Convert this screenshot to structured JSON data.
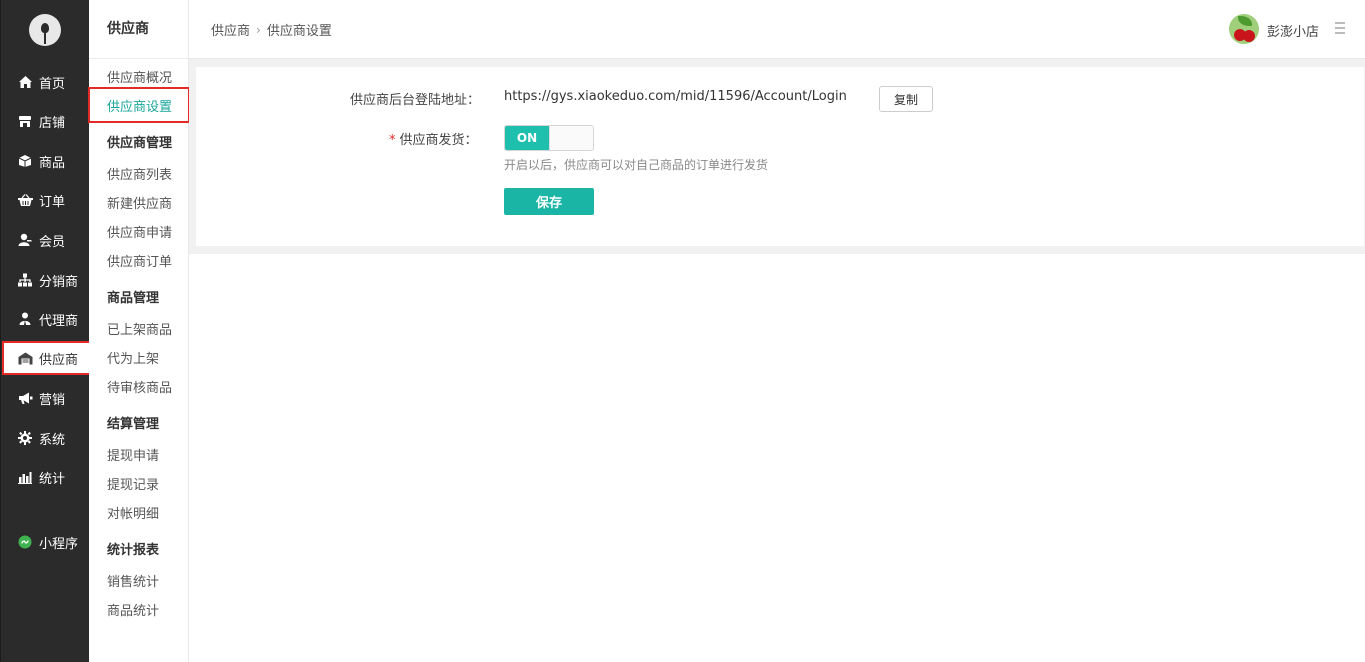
{
  "nav": {
    "items": [
      {
        "label": "首页",
        "icon": "home-icon"
      },
      {
        "label": "店铺",
        "icon": "store-icon"
      },
      {
        "label": "商品",
        "icon": "box-icon"
      },
      {
        "label": "订单",
        "icon": "basket-icon"
      },
      {
        "label": "会员",
        "icon": "member-icon"
      },
      {
        "label": "分销商",
        "icon": "sitemap-icon"
      },
      {
        "label": "代理商",
        "icon": "agent-icon"
      },
      {
        "label": "供应商",
        "icon": "warehouse-icon"
      },
      {
        "label": "营销",
        "icon": "megaphone-icon"
      },
      {
        "label": "系统",
        "icon": "gear-icon"
      },
      {
        "label": "统计",
        "icon": "bar-chart-icon"
      },
      {
        "label": "小程序",
        "icon": "miniprogram-icon"
      }
    ],
    "active_index": 7
  },
  "subnav": {
    "title": "供应商",
    "overview": "供应商概况",
    "settings": "供应商设置",
    "group_supplier": "供应商管理",
    "supplier_list": "供应商列表",
    "new_supplier": "新建供应商",
    "supplier_apply": "供应商申请",
    "supplier_orders": "供应商订单",
    "group_goods": "商品管理",
    "goods_listed": "已上架商品",
    "goods_proxy": "代为上架",
    "goods_pending": "待审核商品",
    "group_settle": "结算管理",
    "withdraw_apply": "提现申请",
    "withdraw_records": "提现记录",
    "statement": "对帐明细",
    "group_report": "统计报表",
    "sales_stats": "销售统计",
    "goods_stats": "商品统计"
  },
  "header": {
    "breadcrumb_root": "供应商",
    "breadcrumb_sep": "›",
    "breadcrumb_current": "供应商设置",
    "shop_name": "彭澎小店"
  },
  "form": {
    "login_label": "供应商后台登陆地址：",
    "login_url": "https://gys.xiaokeduo.com/mid/11596/Account/Login",
    "copy_label": "复制",
    "required_mark": "*",
    "ship_label": "供应商发货：",
    "toggle_on": "ON",
    "toggle_state": true,
    "hint": "开启以后，供应商可以对自己商品的订单进行发货",
    "save_label": "保存"
  },
  "colors": {
    "accent": "#1bb5a6",
    "nav_bg": "#2b2b2b",
    "highlight_border": "#e02b27"
  }
}
